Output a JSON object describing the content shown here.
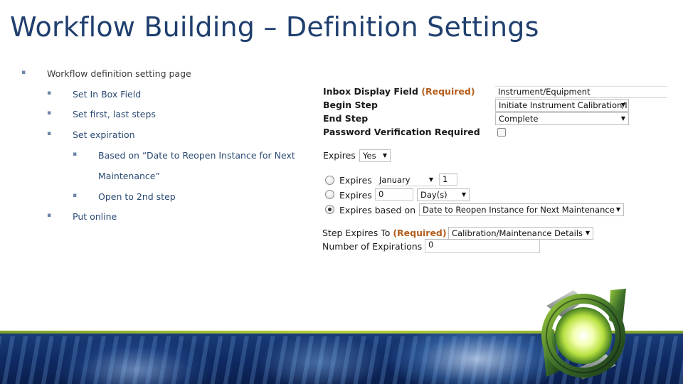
{
  "title": "Workflow Building – Definition Settings",
  "bullets": [
    {
      "level": 1,
      "text": "Workflow definition setting page"
    },
    {
      "level": 2,
      "text": "Set In Box Field"
    },
    {
      "level": 2,
      "text": "Set first, last steps"
    },
    {
      "level": 2,
      "text": "Set expiration"
    },
    {
      "level": 3,
      "text": "Based on “Date to Reopen Instance for Next"
    },
    {
      "level": 3,
      "text": "Maintenance”",
      "continuation": true
    },
    {
      "level": 3,
      "text": "Open to 2nd step"
    },
    {
      "level": 2,
      "text": "Put online"
    }
  ],
  "form": {
    "inbox_display_field": {
      "label": "Inbox Display Field",
      "required": "(Required)",
      "value": "Instrument/Equipment"
    },
    "begin_step": {
      "label": "Begin Step",
      "value": "Initiate Instrument Calibration/I"
    },
    "end_step": {
      "label": "End Step",
      "value": "Complete"
    },
    "password_verification": {
      "label": "Password Verification Required",
      "checked": false
    },
    "expires": {
      "label": "Expires",
      "value": "Yes"
    },
    "expire_options": [
      {
        "label": "Expires",
        "selected": false,
        "month": "January",
        "day": "1"
      },
      {
        "label": "Expires",
        "selected": false,
        "amount": "0",
        "unit": "Day(s)"
      },
      {
        "label": "Expires based on",
        "selected": true,
        "value": "Date to Reopen Instance for Next Maintenance"
      }
    ],
    "step_expires_to": {
      "label": "Step Expires To",
      "required": "(Required)",
      "value": "Calibration/Maintenance Details"
    },
    "number_of_expirations": {
      "label": "Number of Expirations",
      "value": "0"
    }
  },
  "colors": {
    "title": "#1f3f6e",
    "required": "#b45d1c",
    "band": "#0f2a63",
    "accent": "#b6d13a"
  },
  "icons": {
    "logo": "green-ring-logo-icon",
    "dropdown": "chevron-down-icon"
  }
}
